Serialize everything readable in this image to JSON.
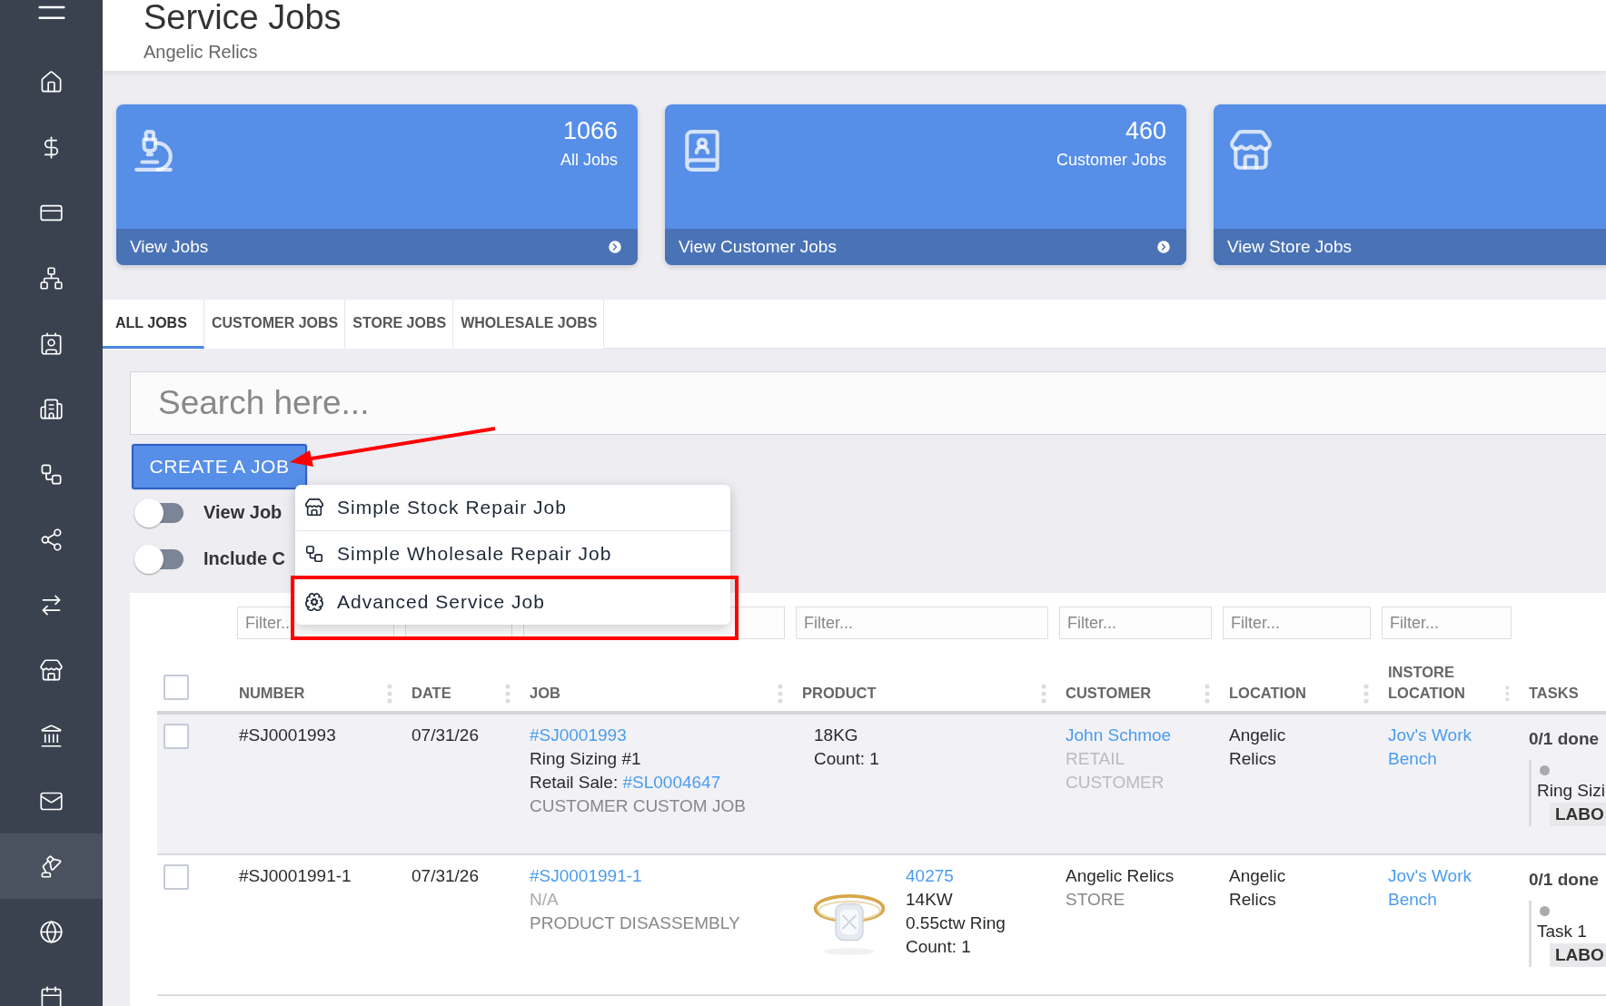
{
  "sidebar": {
    "items": [
      {
        "selected": false
      },
      {
        "selected": false
      },
      {
        "selected": false
      },
      {
        "selected": false
      },
      {
        "selected": false
      },
      {
        "selected": false
      },
      {
        "selected": false
      },
      {
        "selected": false
      },
      {
        "selected": false
      },
      {
        "selected": false
      },
      {
        "selected": false
      },
      {
        "selected": false
      },
      {
        "selected": false
      },
      {
        "selected": true
      },
      {
        "selected": false
      },
      {
        "selected": false
      }
    ]
  },
  "header": {
    "title": "Service Jobs",
    "subtitle": "Angelic Relics"
  },
  "cards": [
    {
      "count": "1066",
      "label": "All Jobs",
      "link": "View Jobs",
      "arrow": true
    },
    {
      "count": "460",
      "label": "Customer Jobs",
      "link": "View Customer Jobs",
      "arrow": true
    },
    {
      "link": "View Store Jobs"
    }
  ],
  "tabs": [
    {
      "label": "ALL JOBS",
      "selected": true
    },
    {
      "label": "CUSTOMER JOBS",
      "selected": false
    },
    {
      "label": "STORE JOBS",
      "selected": false
    },
    {
      "label": "WHOLESALE JOBS",
      "selected": false
    }
  ],
  "search": {
    "placeholder": "Search here..."
  },
  "create_button": {
    "label": "CREATE A JOB",
    "pointed_at": true
  },
  "toggles": [
    {
      "label": "View Job",
      "on": false
    },
    {
      "label": "Include C",
      "on": false
    }
  ],
  "menu": {
    "items": [
      {
        "label": "Simple Stock Repair Job",
        "highlighted": false
      },
      {
        "label": "Simple Wholesale Repair Job",
        "highlighted": false
      },
      {
        "label": "Advanced Service Job",
        "highlighted": true
      }
    ]
  },
  "table": {
    "all_checked": false,
    "filters": [
      {
        "placeholder": "Filter.."
      },
      {
        "placeholder": "Filter..."
      },
      {
        "placeholder": "Filter..."
      },
      {
        "placeholder": "Filter..."
      },
      {
        "placeholder": "Filter..."
      }
    ],
    "columns": [
      "NUMBER",
      "DATE",
      "JOB",
      "PRODUCT",
      "CUSTOMER",
      "LOCATION",
      "INSTORE LOCATION",
      "TASKS"
    ],
    "rows": [
      {
        "checked": false,
        "number": "#SJ0001993",
        "date": "07/31/26",
        "job": {
          "link": "#SJ0001993",
          "name": "Ring Sizing #1",
          "sale_label": "Retail Sale: ",
          "sale_link": "#SL0004647",
          "type": "CUSTOMER CUSTOM JOB"
        },
        "product": {
          "lines": [
            "18KG",
            "Count: 1"
          ]
        },
        "customer": {
          "name": "John Schmoe",
          "is_link": true,
          "type": "RETAIL CUSTOMER"
        },
        "location": "Angelic Relics",
        "instore": "Jov's Work Bench",
        "tasks": {
          "summary": "0/1 done",
          "task": "Ring Sizi",
          "tag": "LABO"
        }
      },
      {
        "checked": false,
        "number": "#SJ0001991-1",
        "date": "07/31/26",
        "job": {
          "link": "#SJ0001991-1",
          "name": "N/A",
          "type": "PRODUCT DISASSEMBLY"
        },
        "product": {
          "picture": true,
          "link": "40275",
          "lines": [
            "14KW",
            "0.55ctw Ring",
            "Count: 1"
          ]
        },
        "customer": {
          "name": "Angelic Relics",
          "is_link": false,
          "type": "STORE"
        },
        "location": "Angelic Relics",
        "instore": "Jov's Work Bench",
        "tasks": {
          "summary": "0/1 done",
          "task": "Task 1",
          "tag": "LABO"
        }
      }
    ]
  }
}
